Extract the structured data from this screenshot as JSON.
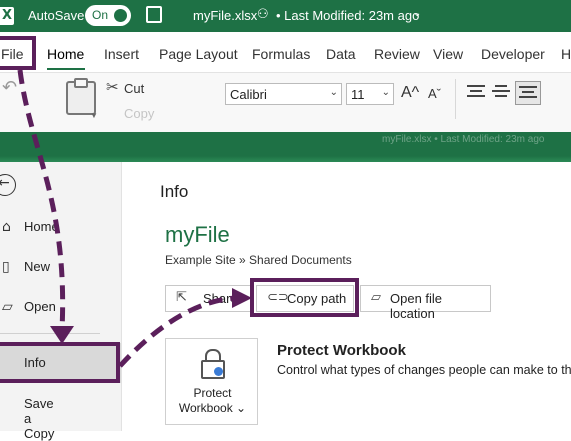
{
  "titlebar": {
    "autosave_label": "AutoSave",
    "autosave_state": "On",
    "filename": "myFile.xlsx",
    "modified": "• Last Modified: 23m ago",
    "caret": "⌄"
  },
  "tabs": [
    "File",
    "Home",
    "Insert",
    "Page Layout",
    "Formulas",
    "Data",
    "Review",
    "View",
    "Developer",
    "H"
  ],
  "active_tab": "Home",
  "ribbon": {
    "cut_label": "Cut",
    "copy_label": "Copy",
    "font_name": "Calibri",
    "font_size": "11",
    "grow_font": "A^",
    "shrink_font": "Aˇ"
  },
  "backstage_band_text": "myFile.xlsx  •  Last Modified: 23m ago",
  "nav": {
    "home": "Home",
    "new": "New",
    "open": "Open",
    "info": "Info",
    "save_copy": "Save a Copy"
  },
  "info": {
    "title": "Info",
    "doc_name": "myFile",
    "doc_path": "Example Site » Shared Documents",
    "share_label": "Share",
    "copy_path_label": "Copy path",
    "open_location_label": "Open file location",
    "protect_button_line1": "Protect",
    "protect_button_line2": "Workbook ⌄",
    "protect_heading": "Protect Workbook",
    "protect_desc": "Control what types of changes people can make to this w"
  },
  "colors": {
    "excel_green": "#1e7145",
    "annotation_purple": "#5b1f5b"
  }
}
